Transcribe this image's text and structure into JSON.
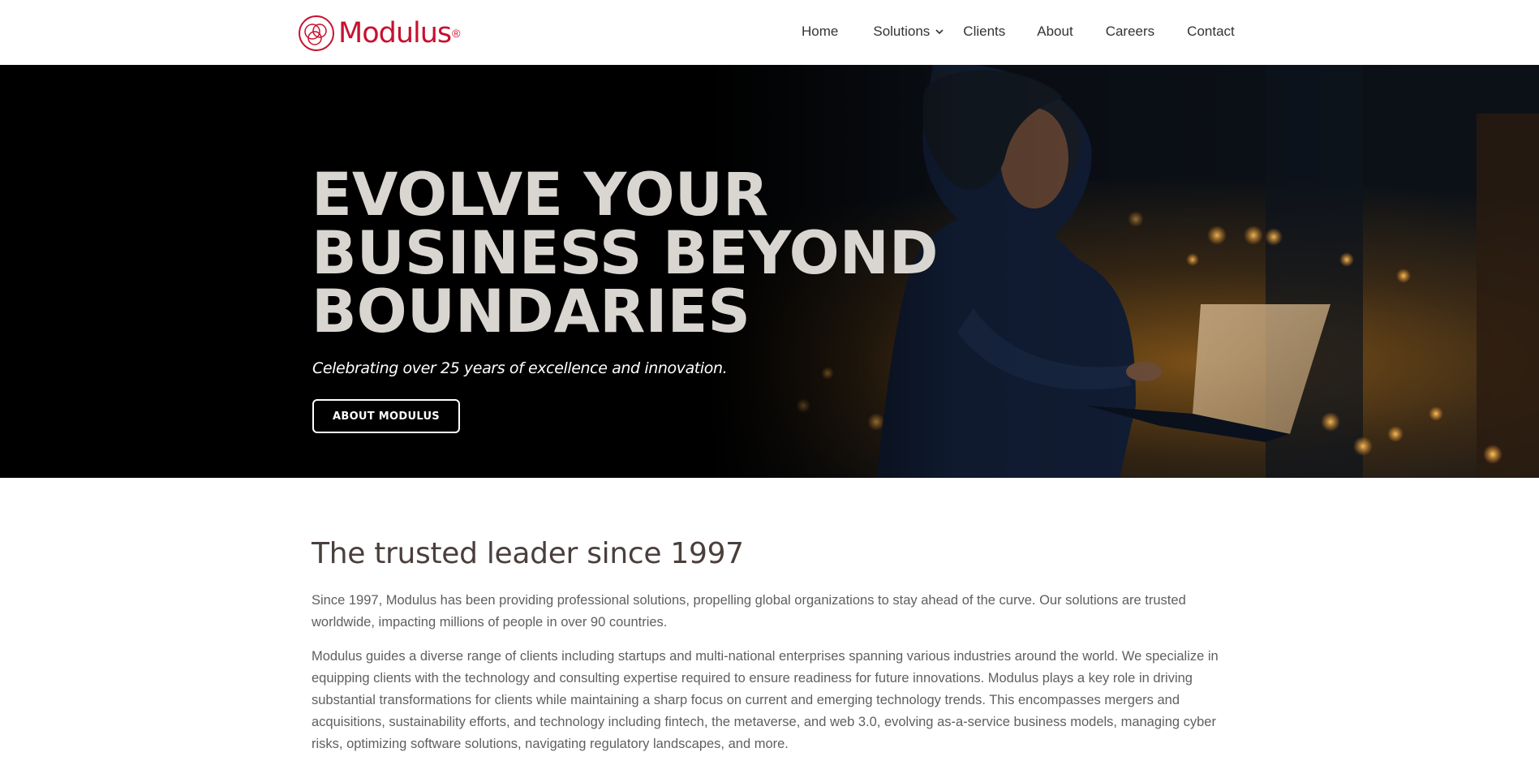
{
  "header": {
    "logo_text": "Modulus",
    "logo_dot": "®",
    "nav": [
      {
        "label": "Home"
      },
      {
        "label": "Solutions"
      },
      {
        "label": "Clients"
      },
      {
        "label": "About"
      },
      {
        "label": "Careers"
      },
      {
        "label": "Contact"
      }
    ]
  },
  "hero": {
    "title_lines": [
      "EVOLVE YOUR",
      "BUSINESS BEYOND",
      "BOUNDARIES"
    ],
    "subtitle": "Celebrating over 25 years of excellence and innovation.",
    "button_label": "ABOUT MODULUS"
  },
  "content": {
    "title": "The trusted leader since 1997",
    "paragraphs": [
      "Since 1997, Modulus has been providing professional solutions, propelling global organizations to stay ahead of the curve. Our solutions are trusted worldwide, impacting millions of people in over 90 countries.",
      "Modulus guides a diverse range of clients including startups and multi-national enterprises spanning various industries around the world. We specialize in equipping clients with the technology and consulting expertise required to ensure readiness for future innovations. Modulus plays a key role in driving substantial transformations for clients while maintaining a sharp focus on current and emerging technology trends. This encompasses mergers and acquisitions, sustainability efforts, and technology including fintech, the metaverse, and web 3.0, evolving as-a-service business models, managing cyber risks, optimizing software solutions, navigating regulatory landscapes, and more."
    ]
  },
  "colors": {
    "brand": "#c8102e",
    "hero_title": "#d9d6d1",
    "heading": "#4a3f3c",
    "body_text": "#5f5f5f"
  },
  "icons": {
    "logo": "modulus-circles-logo-icon",
    "solutions_dropdown": "chevron-down-icon"
  }
}
